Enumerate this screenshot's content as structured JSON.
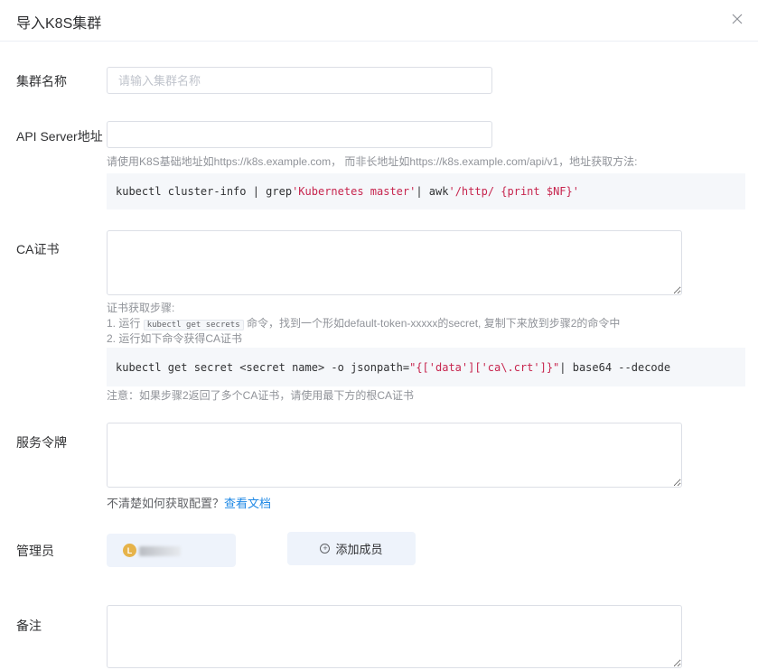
{
  "dialog": {
    "title": "导入K8S集群",
    "close_icon": "close-icon"
  },
  "form": {
    "cluster_name": {
      "label": "集群名称",
      "placeholder": "请输入集群名称",
      "value": ""
    },
    "api_server": {
      "label": "API Server地址",
      "value": "",
      "hint": "请使用K8S基础地址如https://k8s.example.com， 而非长地址如https://k8s.example.com/api/v1，地址获取方法:",
      "command": {
        "prefix": "kubectl cluster-info | grep ",
        "str1": "'Kubernetes master'",
        "mid": " | awk ",
        "str2": "'/http/ {print $NF}'"
      }
    },
    "ca_cert": {
      "label": "CA证书",
      "value": "",
      "hint_title": "证书获取步骤:",
      "step1_prefix": "1. 运行",
      "step1_code": "kubectl get secrets",
      "step1_suffix": "命令，找到一个形如default-token-xxxxx的secret, 复制下来放到步骤2的命令中",
      "step2": "2. 运行如下命令获得CA证书",
      "command": {
        "prefix": "kubectl get secret <secret name> -o jsonpath=",
        "str1": "\"{['data']['ca\\.crt']}\"",
        "suffix": " | base64 --decode"
      },
      "note": "注意：如果步骤2返回了多个CA证书，请使用最下方的根CA证书"
    },
    "token": {
      "label": "服务令牌",
      "value": "",
      "doc_text": "不清楚如何获取配置？",
      "doc_link": "查看文档"
    },
    "admins": {
      "label": "管理员",
      "members": [
        {
          "avatar_letter": "L"
        }
      ],
      "add_label": "添加成员",
      "add_icon": "plus-circle-icon"
    },
    "remark": {
      "label": "备注",
      "value": ""
    }
  }
}
